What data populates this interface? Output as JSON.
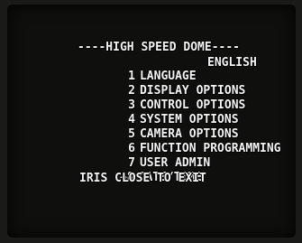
{
  "menu": {
    "title": "----HIGH SPEED DOME----",
    "items": [
      {
        "number": "1",
        "label": "LANGUAGE"
      },
      {
        "number": "2",
        "label": "DISPLAY OPTIONS"
      },
      {
        "number": "3",
        "label": "CONTROL OPTIONS"
      },
      {
        "number": "4",
        "label": "SYSTEM OPTIONS"
      },
      {
        "number": "5",
        "label": "CAMERA OPTIONS"
      },
      {
        "number": "6",
        "label": "FUNCTION PROGRAMMING"
      },
      {
        "number": "7",
        "label": "USER ADMIN"
      },
      {
        "number": "8",
        "label": "DATE/TIME"
      }
    ],
    "language_value": "ENGLISH",
    "cursor": "→",
    "exit_hint": "IRIS CLOSE TO EXIT"
  }
}
